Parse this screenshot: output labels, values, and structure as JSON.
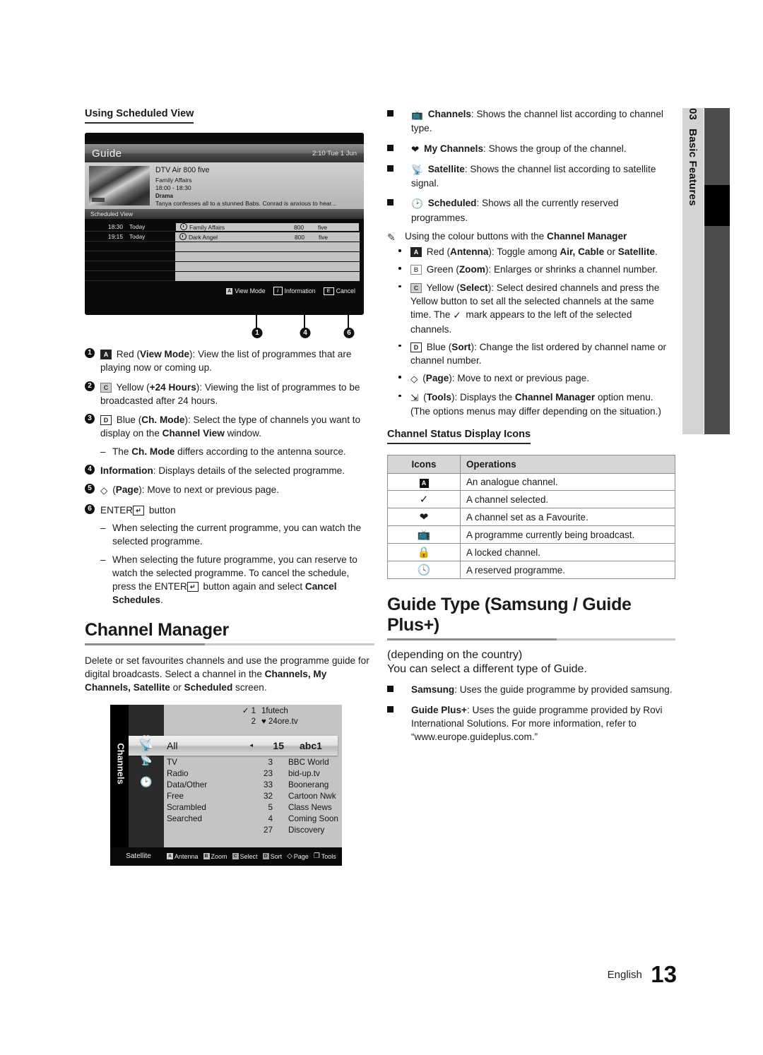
{
  "side_tab": {
    "number": "03",
    "label": "Basic Features"
  },
  "footer": {
    "language": "English",
    "page": "13"
  },
  "left": {
    "heading": "Using Scheduled View",
    "guide_mock": {
      "title": "Guide",
      "time": "2:10 Tue 1 Jun",
      "info": {
        "line1": "DTV Air 800 five",
        "line2": "Family Affairs",
        "line3": "18:00 - 18:30",
        "genre": "Drama",
        "desc": "Tanya confesses all to a stunned Babs. Conrad is anxious to hear..."
      },
      "section_label": "Scheduled View",
      "rows": [
        {
          "time": "18:30",
          "day": "Today",
          "name": "Family Affairs",
          "number": "800",
          "channel": "five",
          "selected": true
        },
        {
          "time": "19:15",
          "day": "Today",
          "name": "Dark Angel",
          "number": "800",
          "channel": "five",
          "selected": false
        }
      ],
      "empty_rows": 4,
      "footer_buttons": [
        {
          "key": "A",
          "label": "View Mode"
        },
        {
          "key": "i",
          "label": "Information"
        },
        {
          "key": "E",
          "label": "Cancel"
        }
      ]
    },
    "callouts": [
      "1",
      "4",
      "6"
    ],
    "numbered_items": [
      {
        "num": "1",
        "html": "<span class=\"keybox red\">A</span> Red (<b>View Mode</b>): View the list of programmes that are playing now or coming up."
      },
      {
        "num": "2",
        "html": "<span class=\"keybox yel\">C</span> Yellow (<b>+24 Hours</b>): Viewing the list of programmes to be broadcasted after 24 hours."
      },
      {
        "num": "3",
        "html": "<span class=\"keybox blu\">D</span> Blue (<b>Ch. Mode</b>): Select the type of channels you want to display on the <b>Channel View</b> window.",
        "sub": [
          "The <b>Ch. Mode</b> differs according to the antenna source."
        ]
      },
      {
        "num": "4",
        "html": "<b>Information</b>: Displays details of the selected programme."
      },
      {
        "num": "5",
        "html": "<span class=\"glyph\">&#9671;</span> (<b>Page</b>): Move to next or previous page."
      },
      {
        "num": "6",
        "html": "ENTER<span class=\"keybox blu\">&#8629;</span> button",
        "sub": [
          "When selecting the current programme, you can watch the selected programme.",
          "When selecting the future programme, you can reserve to watch the selected programme. To cancel the schedule, press the ENTER<span class=\"keybox blu\">&#8629;</span> button again and select <b>Cancel Schedules</b>."
        ]
      }
    ],
    "channel_manager": {
      "heading": "Channel Manager",
      "body": "Delete or set favourites channels and use the programme guide for digital broadcasts. Select a channel in the <b>Channels, My Channels, Satellite</b> or <b>Scheduled</b> screen.",
      "mock": {
        "tab_label": "Channels",
        "preview_rows": [
          {
            "mark": "✓",
            "number": "1",
            "name": "1futech"
          },
          {
            "mark": "",
            "number": "2",
            "name": "♥ 24ore.tv"
          }
        ],
        "highlight": {
          "category": "All",
          "arrow": "◂",
          "number": "15",
          "name": "abc1"
        },
        "categories": [
          "TV",
          "Radio",
          "Data/Other",
          "Free",
          "Scrambled",
          "Searched"
        ],
        "numbers": [
          "3",
          "23",
          "33",
          "32",
          "5",
          "4",
          "27"
        ],
        "names": [
          "BBC World",
          "bid-up.tv",
          "Boonerang",
          "Cartoon Nwk",
          "Class News",
          "Coming Soon",
          "Discovery"
        ],
        "footer_label": "Satellite",
        "footer_buttons": [
          {
            "key": "A",
            "label": "Antenna"
          },
          {
            "key": "B",
            "label": "Zoom"
          },
          {
            "key": "C",
            "label": "Select"
          },
          {
            "key": "D",
            "label": "Sort"
          },
          {
            "key": "◇",
            "label": "Page"
          },
          {
            "key": "❐",
            "label": "Tools"
          }
        ]
      }
    }
  },
  "right": {
    "square_items": [
      {
        "icon": "channels-icon",
        "html": "<span class=\"glyph\">&#128250;</span> <b>Channels</b>: Shows the channel list according to channel type."
      },
      {
        "icon": "heart-icon",
        "html": "<span class=\"glyph\">&#10084;</span> <b>My Channels</b>: Shows the group of the channel."
      },
      {
        "icon": "satellite-icon",
        "html": "<span class=\"glyph\">&#128225;</span> <b>Satellite</b>: Shows the channel list according to satellite signal."
      },
      {
        "icon": "clock-icon",
        "html": "<span class=\"glyph\">&#128337;</span> <b>Scheduled</b>: Shows all the currently reserved programmes."
      }
    ],
    "note_title": "Using the colour buttons with the <b>Channel Manager</b>",
    "note_items": [
      "<span class=\"keybox red\">A</span> Red (<b>Antenna</b>): Toggle among <b>Air, Cable</b> or <b>Satellite</b>.",
      "<span class=\"keybox grn\">B</span> Green (<b>Zoom</b>): Enlarges or shrinks a channel number.",
      "<span class=\"keybox yel\">C</span> Yellow (<b>Select</b>): Select desired channels and press the Yellow button to set all the selected channels at the same time. The <span class=\"glyph\">&#10003;</span> mark appears to the left of the selected channels.",
      "<span class=\"keybox blu\">D</span> Blue (<b>Sort</b>): Change the list ordered by channel name or channel number.",
      "<span class=\"glyph\">&#9671;</span> (<b>Page</b>): Move to next or previous page.",
      "<span class=\"glyph\">&#8690;</span> (<b>Tools</b>): Displays the <b>Channel Manager</b> option menu. (The options menus may differ depending on the situation.)"
    ],
    "table": {
      "heading": "Channel Status Display Icons",
      "columns": [
        "Icons",
        "Operations"
      ],
      "rows": [
        {
          "icon": "A",
          "icon_kind": "analogue",
          "operation": "An analogue channel."
        },
        {
          "icon": "✓",
          "icon_kind": "check",
          "operation": "A channel selected."
        },
        {
          "icon": "♥",
          "icon_kind": "heart",
          "operation": "A channel set as a Favourite."
        },
        {
          "icon": "὏a",
          "icon_kind": "tv",
          "operation": "A programme currently being broadcast."
        },
        {
          "icon": "🔒",
          "icon_kind": "lock",
          "operation": "A locked channel."
        },
        {
          "icon": "◔",
          "icon_kind": "clock",
          "operation": "A reserved programme."
        }
      ]
    },
    "guide_type": {
      "heading": "Guide Type (Samsung / Guide Plus+)",
      "note": "(depending on the country)",
      "intro": "You can select a different type of Guide.",
      "items": [
        "<b>Samsung</b>: Uses the guide programme by provided samsung.",
        "<b>Guide Plus+</b>: Uses the guide programme provided by Rovi International Solutions. For more information, refer to “www.europe.guideplus.com.”"
      ]
    }
  }
}
